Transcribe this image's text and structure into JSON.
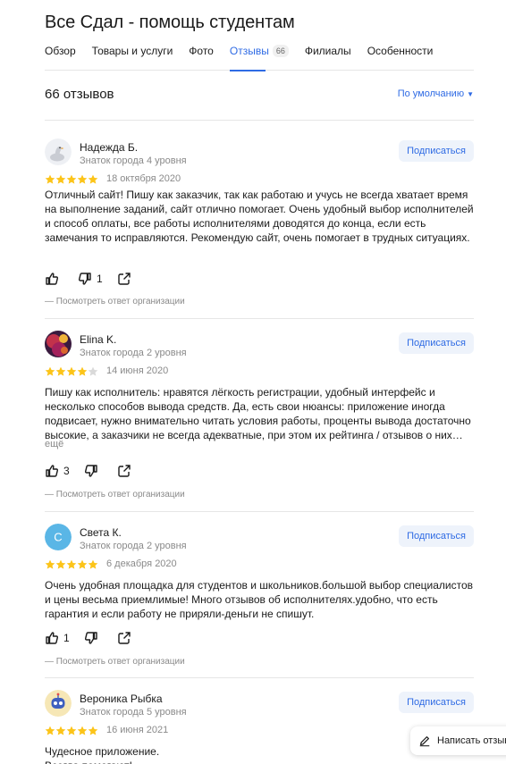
{
  "organization": {
    "title": "Все Сдал - помощь студентам"
  },
  "tabs": [
    {
      "label": "Обзор",
      "active": false
    },
    {
      "label": "Товары и услуги",
      "active": false
    },
    {
      "label": "Фото",
      "active": false
    },
    {
      "label": "Отзывы",
      "active": true,
      "count": "66"
    },
    {
      "label": "Филиалы",
      "active": false
    },
    {
      "label": "Особенности",
      "active": false
    }
  ],
  "reviews_header": {
    "count_text": "66 отзывов",
    "sort_label": "По умолчанию",
    "sort_icon": "caret-down-icon"
  },
  "reviews": [
    {
      "author": "Надежда Б.",
      "level": "Знаток города 4 уровня",
      "avatar_icon": "goose-avatar",
      "subscribe": "Подписаться",
      "rating": 5,
      "date": "18 октября 2020",
      "text": "Отличный сайт! Пишу как заказчик, так как работаю и учусь не всегда хватает время на выполнение заданий, сайт отлично помогает. Очень удобный выбор исполнителей и способ оплаты, все работы исполнителями доводятся до конца, если есть замечания то исправляются. Рекомендую сайт, очень помогает в трудных ситуациях.",
      "more": "",
      "likes": "",
      "dislikes": "1",
      "org_answer": "— Посмотреть ответ организации"
    },
    {
      "author": "Elina K.",
      "level": "Знаток города 2 уровня",
      "avatar_icon": "photo-avatar",
      "subscribe": "Подписаться",
      "rating": 4,
      "date": "14 июня 2020",
      "text": "Пишу как исполнитель: нравятся лёгкость регистрации, удобный интерфейс и несколько способов вывода средств. Да, есть свои нюансы: приложение иногда подвисает, нужно внимательно читать условия работы, проценты вывода достаточно высокие, а заказчики не всегда адекватные, при этом их рейтинга / отзывов о них…",
      "more": "ещё",
      "likes": "3",
      "dislikes": "",
      "org_answer": "— Посмотреть ответ организации"
    },
    {
      "author": "Света К.",
      "level": "Знаток города 2 уровня",
      "avatar_letter": "С",
      "avatar_color": "#5ab6e6",
      "subscribe": "Подписаться",
      "rating": 5,
      "date": "6 декабря 2020",
      "text": "Очень удобная площадка для студентов и школьников.большой выбор специалистов и цены весьма приемлимые! Много отзывов об исполнителях.удобно, что есть гарантия и если работу не приряли-деньги не спишут.",
      "more": "",
      "likes": "1",
      "dislikes": "",
      "org_answer": "— Посмотреть ответ организации"
    },
    {
      "author": "Вероника Рыбка",
      "level": "Знаток города 5 уровня",
      "avatar_icon": "robot-avatar",
      "subscribe": "Подписаться",
      "rating": 5,
      "date": "16 июня 2021",
      "text": "Чудесное приложение.\nВсегда помогают!"
    }
  ],
  "write_review": {
    "label": "Написать отзыв",
    "icon": "pencil-icon"
  },
  "colors": {
    "accent": "#2f6be4",
    "star": "#fcc419",
    "star_empty": "#d9d9d9",
    "muted": "#8a8a8a"
  }
}
